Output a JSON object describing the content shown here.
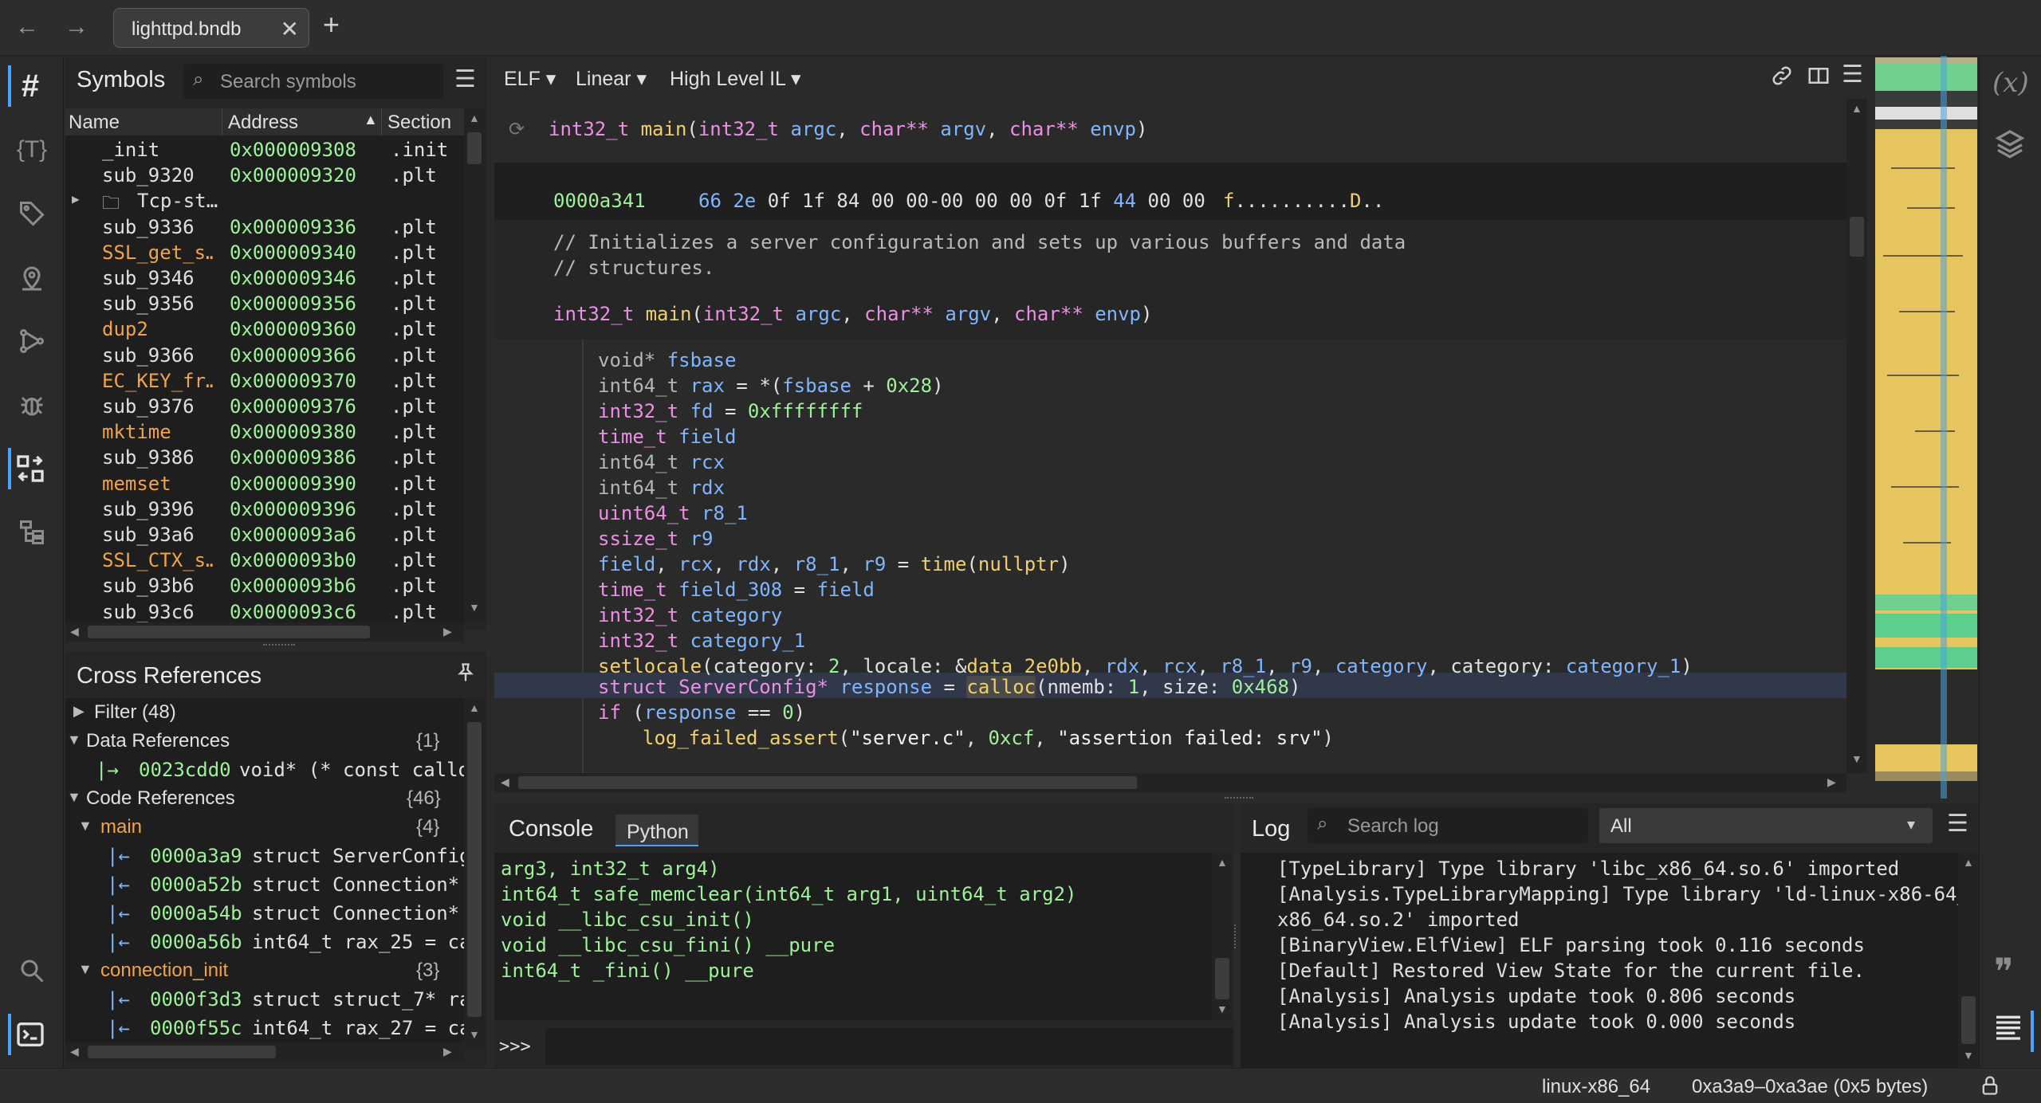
{
  "tabs": [
    {
      "label": "lighttpd.bndb"
    }
  ],
  "symbols": {
    "title": "Symbols",
    "search_placeholder": "Search symbols",
    "columns": [
      "Name",
      "Address",
      "Section"
    ],
    "rows": [
      {
        "name": "_init",
        "address": "0x000009308",
        "section": ".init",
        "kind": "plain"
      },
      {
        "name": "sub_9320",
        "address": "0x000009320",
        "section": ".plt",
        "kind": "plain"
      },
      {
        "name": "Tcp-st…",
        "address": "",
        "section": "",
        "kind": "folder"
      },
      {
        "name": "sub_9336",
        "address": "0x000009336",
        "section": ".plt",
        "kind": "plain"
      },
      {
        "name": "SSL_get_s…",
        "address": "0x000009340",
        "section": ".plt",
        "kind": "import"
      },
      {
        "name": "sub_9346",
        "address": "0x000009346",
        "section": ".plt",
        "kind": "plain"
      },
      {
        "name": "sub_9356",
        "address": "0x000009356",
        "section": ".plt",
        "kind": "plain"
      },
      {
        "name": "dup2",
        "address": "0x000009360",
        "section": ".plt",
        "kind": "import"
      },
      {
        "name": "sub_9366",
        "address": "0x000009366",
        "section": ".plt",
        "kind": "plain"
      },
      {
        "name": "EC_KEY_fr…",
        "address": "0x000009370",
        "section": ".plt",
        "kind": "import"
      },
      {
        "name": "sub_9376",
        "address": "0x000009376",
        "section": ".plt",
        "kind": "plain"
      },
      {
        "name": "mktime",
        "address": "0x000009380",
        "section": ".plt",
        "kind": "import"
      },
      {
        "name": "sub_9386",
        "address": "0x000009386",
        "section": ".plt",
        "kind": "plain"
      },
      {
        "name": "memset",
        "address": "0x000009390",
        "section": ".plt",
        "kind": "import"
      },
      {
        "name": "sub_9396",
        "address": "0x000009396",
        "section": ".plt",
        "kind": "plain"
      },
      {
        "name": "sub_93a6",
        "address": "0x0000093a6",
        "section": ".plt",
        "kind": "plain"
      },
      {
        "name": "SSL_CTX_s…",
        "address": "0x0000093b0",
        "section": ".plt",
        "kind": "import"
      },
      {
        "name": "sub_93b6",
        "address": "0x0000093b6",
        "section": ".plt",
        "kind": "plain"
      },
      {
        "name": "sub_93c6",
        "address": "0x0000093c6",
        "section": ".plt",
        "kind": "plain"
      }
    ]
  },
  "xrefs": {
    "title": "Cross References",
    "filter": "Filter (48)",
    "data_refs": {
      "label": "Data References",
      "count": "{1}"
    },
    "data_items": [
      {
        "addr": "0023cdd0",
        "text": "void* (* const callo"
      }
    ],
    "code_refs": {
      "label": "Code References",
      "count": "{46}"
    },
    "groups": [
      {
        "name": "main",
        "count": "{4}",
        "items": [
          {
            "addr": "0000a3a9",
            "text": "struct ServerConfig"
          },
          {
            "addr": "0000a52b",
            "text": "struct Connection*"
          },
          {
            "addr": "0000a54b",
            "text": "struct Connection*"
          },
          {
            "addr": "0000a56b",
            "text": "int64_t rax_25 = ca"
          }
        ]
      },
      {
        "name": "connection_init",
        "count": "{3}",
        "items": [
          {
            "addr": "0000f3d3",
            "text": "struct struct_7* ra"
          },
          {
            "addr": "0000f55c",
            "text": "int64_t rax_27 = ca"
          }
        ]
      }
    ]
  },
  "view_toolbar": {
    "view_type": "ELF",
    "layout": "Linear",
    "il": "High Level IL"
  },
  "code": {
    "header_sig": "int32_t main(int32_t argc, char** argv, char** envp)",
    "hex_addr": "0000a341",
    "hex_bytes": "66 2e 0f 1f 84 00 00-00 00 00 0f 1f 44 00 00",
    "hex_ascii": "f..........D..",
    "comment1": "// Initializes a server configuration and sets up various buffers and data",
    "comment2": "// structures.",
    "highlighted_call": "calloc"
  },
  "console": {
    "title": "Console",
    "lang_tab": "Python",
    "lines": [
      "arg3, int32_t arg4)",
      "int64_t safe_memclear(int64_t arg1, uint64_t arg2)",
      "void __libc_csu_init()",
      "void __libc_csu_fini() __pure",
      "int64_t _fini() __pure"
    ],
    "prompt": ">>>"
  },
  "log": {
    "title": "Log",
    "search_placeholder": "Search log",
    "level": "All",
    "lines": [
      "[TypeLibrary] Type library 'libc_x86_64.so.6' imported",
      "[Analysis.TypeLibraryMapping] Type library 'ld-linux-x86-64_",
      "x86_64.so.2' imported",
      "[BinaryView.ElfView] ELF parsing took 0.116 seconds",
      "[Default] Restored View State for the current file.",
      "[Analysis] Analysis update took 0.806 seconds",
      "[Analysis] Analysis update took 0.000 seconds"
    ]
  },
  "status": {
    "platform": "linux-x86_64",
    "selection": "0xa3a9–0xa3ae (0x5 bytes)"
  }
}
